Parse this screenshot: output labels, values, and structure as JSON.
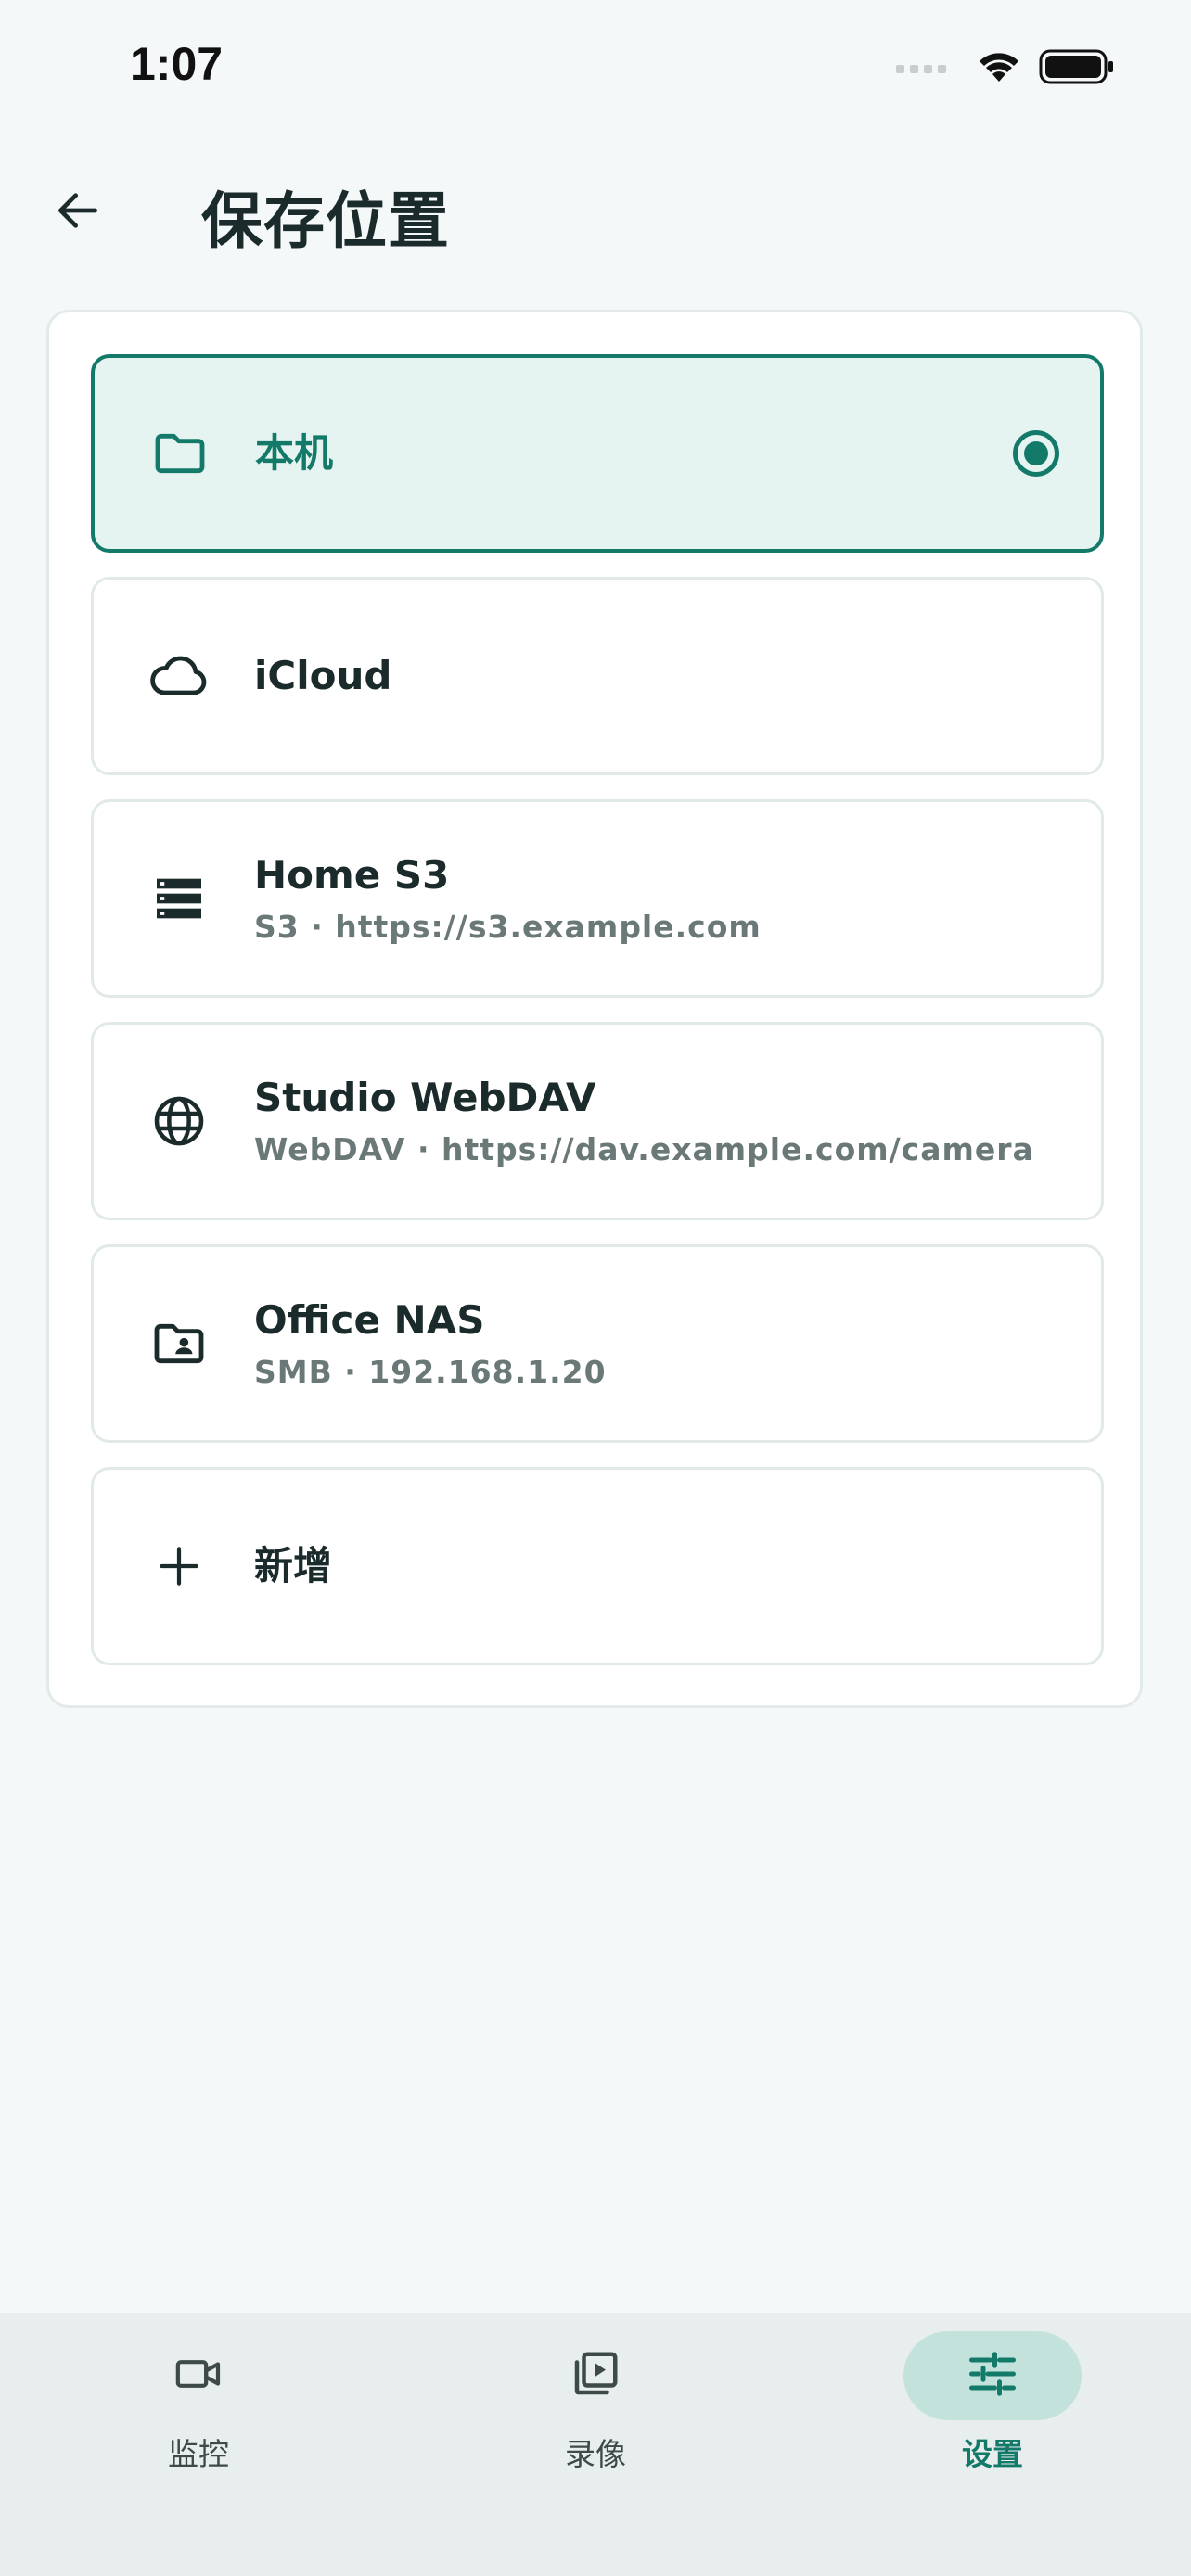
{
  "status_bar": {
    "time": "1:07",
    "icons": [
      "signal-dots-icon",
      "wifi-icon",
      "battery-icon"
    ]
  },
  "header": {
    "back_icon": "arrow-left-icon",
    "title": "保存位置"
  },
  "storage_options": [
    {
      "title": "本机",
      "subtitle": "",
      "icon": "folder-icon",
      "selected": true
    },
    {
      "title": "iCloud",
      "subtitle": "",
      "icon": "cloud-icon",
      "selected": false
    },
    {
      "title": "Home S3",
      "subtitle": "S3 · https://s3.example.com",
      "icon": "server-icon",
      "selected": false
    },
    {
      "title": "Studio WebDAV",
      "subtitle": "WebDAV · https://dav.example.com/camera",
      "icon": "globe-icon",
      "selected": false
    },
    {
      "title": "Office NAS",
      "subtitle": "SMB · 192.168.1.20",
      "icon": "shared-folder-icon",
      "selected": false
    },
    {
      "title": "新增",
      "subtitle": "",
      "icon": "plus-icon",
      "selected": false
    }
  ],
  "bottom_nav": {
    "items": [
      {
        "label": "监控",
        "icon": "video-camera-icon",
        "active": false
      },
      {
        "label": "录像",
        "icon": "video-library-icon",
        "active": false
      },
      {
        "label": "设置",
        "icon": "sliders-icon",
        "active": true
      }
    ]
  },
  "colors": {
    "accent": "#137a6a",
    "selected_background": "#e6f4f1",
    "page_background": "#f4f8f9",
    "nav_background": "#e8eeee",
    "nav_active_pill": "#c3e2dc"
  }
}
